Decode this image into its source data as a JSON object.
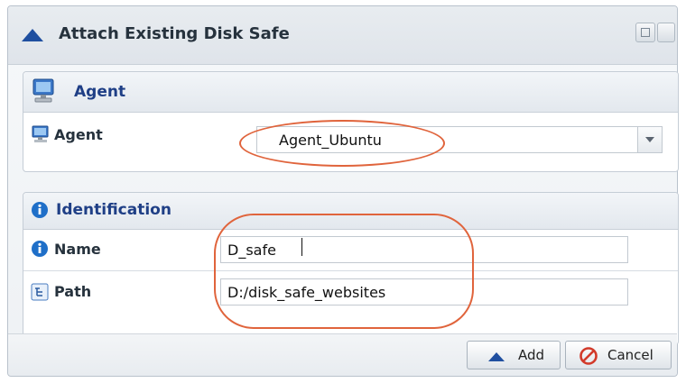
{
  "dialog": {
    "title": "Attach Existing Disk Safe",
    "title_icon": "triangle-up-icon"
  },
  "agent_section": {
    "title": "Agent",
    "agent_label": "Agent",
    "agent_value": "Agent_Ubuntu"
  },
  "identification_section": {
    "title": "Identification",
    "name_label": "Name",
    "name_value": "D_safe",
    "path_label": "Path",
    "path_value": "D:/disk_safe_websites"
  },
  "buttons": {
    "add": "Add",
    "cancel": "Cancel"
  },
  "colors": {
    "accent_blue": "#1f3f86",
    "annotation_orange": "#e0643c",
    "cancel_red": "#d23a2a"
  }
}
